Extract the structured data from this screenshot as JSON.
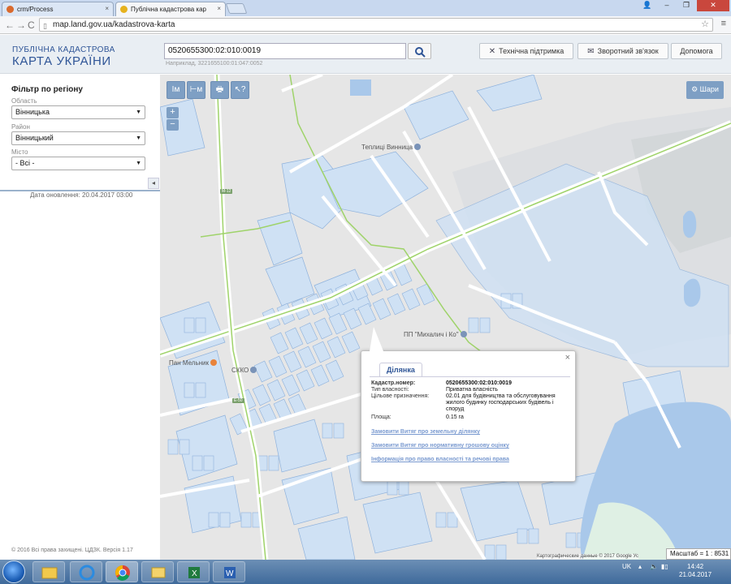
{
  "browser": {
    "tabs": [
      {
        "label": "crm/Process",
        "close": "×"
      },
      {
        "label": "Публічна кадастрова кар",
        "close": "×"
      }
    ],
    "url": "map.land.gov.ua/kadastrova-karta",
    "nav": {
      "back": "←",
      "forward": "→",
      "reload": "C"
    },
    "window": {
      "minimize": "–",
      "restore": "❐",
      "close": "✕",
      "user": "👤"
    }
  },
  "header": {
    "brand_line1": "ПУБЛІЧНА КАДАСТРОВА",
    "brand_line2": "КАРТА УКРАЇНИ",
    "search_value": "0520655300:02:010:0019",
    "search_hint": "Наприклад, 3221655100:01:047:0052",
    "buttons": [
      "Технічна підтримка",
      "Зворотний зв'язок",
      "Допомога"
    ]
  },
  "sidebar": {
    "title": "Фільтр по регіону",
    "fields": [
      {
        "label": "Область",
        "value": "Вінницька"
      },
      {
        "label": "Район",
        "value": "Вінницький"
      },
      {
        "label": "Місто",
        "value": "- Всі -"
      }
    ],
    "update_text": "Дата оновлення: 20.04.2017 03:00",
    "collapse_glyph": "◂",
    "copyright": "© 2016 Всі права захищені. ЦДЗК. Версія 1.17"
  },
  "map": {
    "tools": [
      "Iм",
      "⊢м",
      "🖶",
      "↖?"
    ],
    "zoom_in": "+",
    "zoom_out": "−",
    "layers_label": "Шари",
    "pois": [
      {
        "label": "Теплиці Винница"
      },
      {
        "label": "ПП \"Михалич і Ко\""
      },
      {
        "label": "Пан Мельник"
      },
      {
        "label": "СККО"
      }
    ],
    "road_labels": [
      "М-12",
      "Е-50"
    ],
    "google_copy": "Картографические данные © 2017 Google   Ус"
  },
  "popup": {
    "close": "×",
    "tab": "Ділянка",
    "rows": [
      {
        "label": "Кадастр.номер:",
        "value": "0520655300:02:010:0019"
      },
      {
        "label": "Тип власності:",
        "value": "Приватна власність"
      },
      {
        "label": "Цільове призначення:",
        "value": "02.01 для будівництва та обслуговування жилого будинку господарських будівель і споруд"
      },
      {
        "label": "Площа:",
        "value": "0.15 га"
      }
    ],
    "links": [
      "Замовити Витяг про земельну ділянку",
      "Замовити Витяг про нормативну грошову оцінку",
      "Інформація про право власності та речові права"
    ]
  },
  "status": {
    "scale": "Масштаб = 1 : 8531"
  },
  "taskbar": {
    "lang": "UK",
    "time": "14:42",
    "date": "21.04.2017",
    "tray_icons": [
      "▴",
      "🔈",
      "▮▯",
      "🖧"
    ]
  },
  "colors": {
    "parcel_fill": "#cfe1f4",
    "parcel_stroke": "#8fb2dc",
    "boundary": "#9fd36a",
    "water": "#a9c8ea",
    "accent": "#2f5597"
  }
}
